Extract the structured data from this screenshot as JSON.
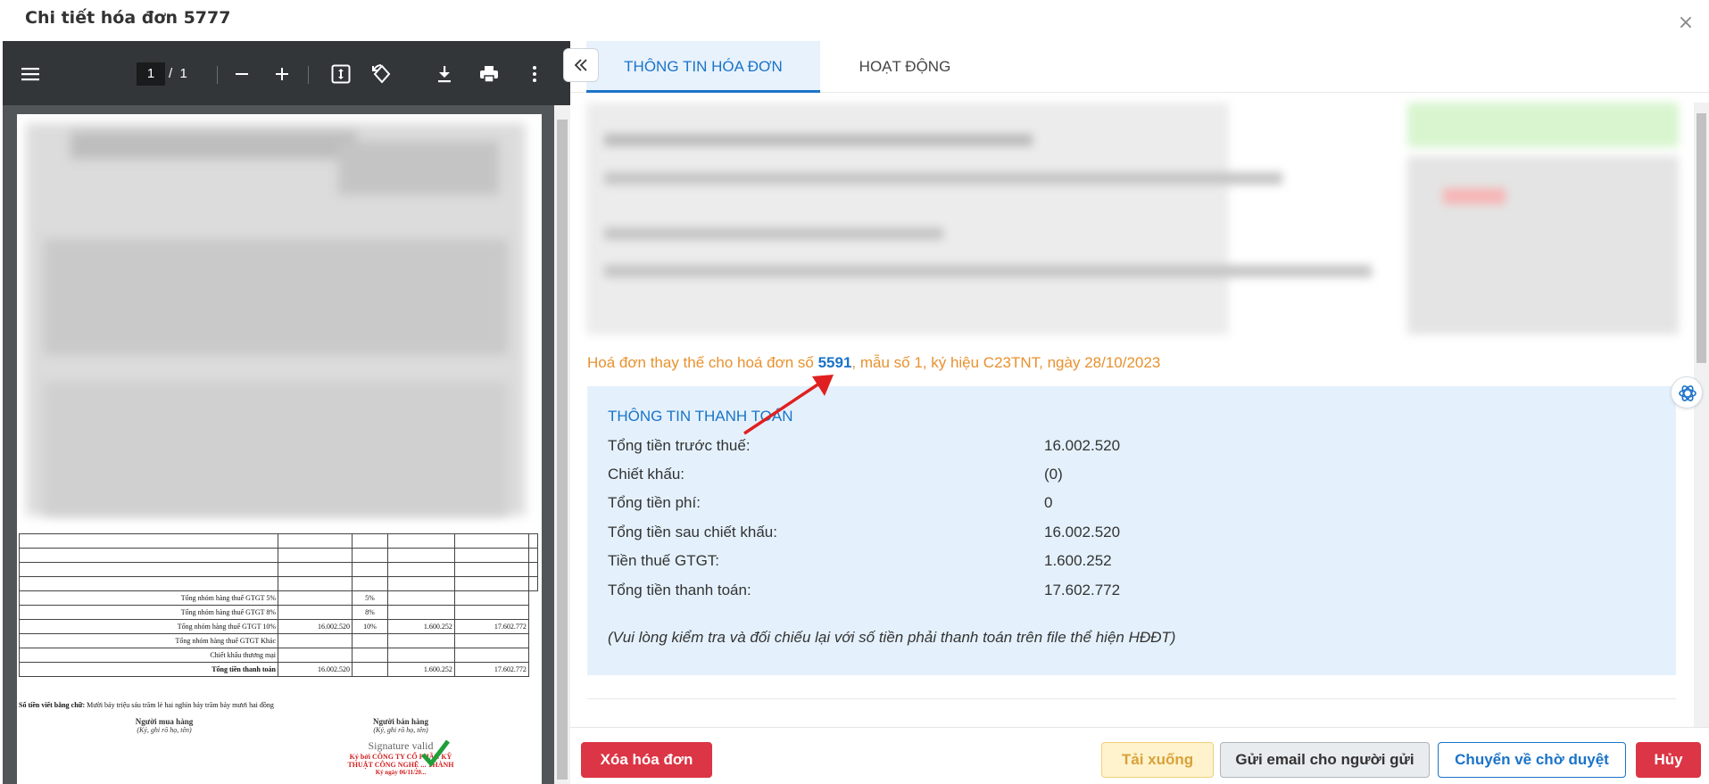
{
  "modal": {
    "title": "Chi tiết hóa đơn 5777",
    "close_glyph": "×"
  },
  "pdf_viewer": {
    "current_page": "1",
    "page_separator": "/",
    "total_pages": "1",
    "table_rows": [
      {
        "label": "Tổng nhóm hàng thuế GTGT 5%",
        "amount": "",
        "rate": "5%",
        "tax": "",
        "total": ""
      },
      {
        "label": "Tổng nhóm hàng thuế GTGT 8%",
        "amount": "",
        "rate": "8%",
        "tax": "",
        "total": ""
      },
      {
        "label": "Tổng nhóm hàng thuế GTGT 10%",
        "amount": "16.002.520",
        "rate": "10%",
        "tax": "1.600.252",
        "total": "17.602.772"
      },
      {
        "label": "Tổng nhóm hàng thuế GTGT Khác",
        "amount": "",
        "rate": "",
        "tax": "",
        "total": ""
      },
      {
        "label": "Chiết khấu thương mại",
        "amount": "",
        "rate": "",
        "tax": "",
        "total": ""
      },
      {
        "label": "Tổng tiền thanh toán",
        "amount": "16.002.520",
        "rate": "",
        "tax": "1.600.252",
        "total": "17.602.772"
      }
    ],
    "amount_in_words_label": "Số tiền viết bằng chữ:",
    "amount_in_words": "Mười bảy triệu sáu trăm lẻ hai nghìn bảy trăm bảy mươi hai đồng",
    "buyer_label": "Người mua hàng",
    "buyer_hint": "(Ký, ghi rõ họ, tên)",
    "seller_label": "Người bán hàng",
    "seller_hint": "(Ký, ghi rõ họ, tên)",
    "signature_status": "Signature valid",
    "signed_by_line1": "Ký bởi CÔNG TY CỔ PHẦN KỸ",
    "signed_by_line2": "THUẬT CÔNG NGHỆ ... THÀNH",
    "signed_date": "Ký ngày 06/11/20..."
  },
  "tabs": [
    {
      "label": "THÔNG TIN HÓA ĐƠN",
      "active": true
    },
    {
      "label": "HOẠT ĐỘNG",
      "active": false
    }
  ],
  "replace_note": {
    "prefix": "Hoá đơn thay thế cho hoá đơn số ",
    "number": "5591",
    "suffix": ", mẫu số 1, ký hiệu C23TNT, ngày 28/10/2023"
  },
  "payment": {
    "title": "THÔNG TIN THANH TOÁN",
    "rows": [
      {
        "label": "Tổng tiền trước thuế:",
        "value": "16.002.520"
      },
      {
        "label": "Chiết khấu:",
        "value": "(0)"
      },
      {
        "label": "Tổng tiền phí:",
        "value": "0"
      },
      {
        "label": "Tổng tiền sau chiết khấu:",
        "value": "16.002.520"
      },
      {
        "label": "Tiền thuế GTGT:",
        "value": "1.600.252"
      },
      {
        "label": "Tổng tiền thanh toán:",
        "value": "17.602.772"
      }
    ],
    "note": "(Vui lòng kiểm tra và đối chiếu lại với số tiền phải thanh toán trên file thể hiện HĐĐT)"
  },
  "footer": {
    "delete_label": "Xóa hóa đơn",
    "download_label": "Tải xuống",
    "email_label": "Gửi email cho người gửi",
    "pending_label": "Chuyển về chờ duyệt",
    "cancel_label": "Hủy"
  },
  "colors": {
    "accent_blue": "#1a73c8",
    "note_orange": "#e8912d",
    "danger_red": "#dc3545",
    "warning_yellow": "#fff3cd",
    "payment_bg": "#e4f1fc",
    "pdf_toolbar": "#323639",
    "annotation_arrow": "#e02020"
  },
  "icons": [
    "menu-icon",
    "zoom-out-icon",
    "zoom-in-icon",
    "fit-page-icon",
    "rotate-icon",
    "download-icon",
    "print-icon",
    "more-vertical-icon",
    "double-chevron-left-icon",
    "close-icon",
    "ai-assistant-icon",
    "checkmark-icon",
    "red-arrow-annotation"
  ]
}
